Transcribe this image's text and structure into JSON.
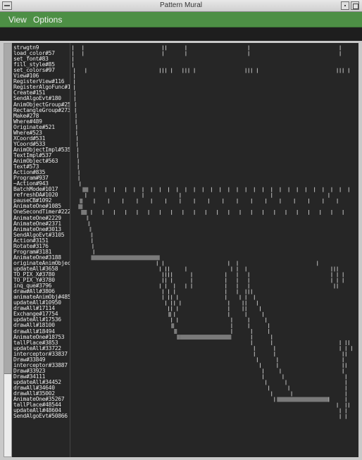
{
  "window": {
    "title": "Pattern Mural"
  },
  "menu": {
    "items": [
      "View",
      "Options"
    ]
  },
  "scrollbar": {
    "thumb_fraction": 0.8
  },
  "colors": {
    "bar": "#7a7a7a",
    "tick": "#bdbdbd",
    "panel": "#262626",
    "menubar": "#4d8f45"
  },
  "chart_data": {
    "type": "event-mural",
    "rows": [
      {
        "label": "strwgtn9",
        "events": [
          {
            "x": 0.005
          },
          {
            "x": 0.04
          },
          {
            "x": 0.32
          },
          {
            "x": 0.33
          },
          {
            "x": 0.4
          },
          {
            "x": 0.62
          },
          {
            "x": 0.94
          }
        ]
      },
      {
        "label": "load_color#57",
        "events": [
          {
            "x": 0.005
          },
          {
            "x": 0.04
          },
          {
            "x": 0.32
          },
          {
            "x": 0.4
          },
          {
            "x": 0.62
          },
          {
            "x": 0.94
          }
        ]
      },
      {
        "label": "set_font#83",
        "events": [
          {
            "x": 0.005
          }
        ]
      },
      {
        "label": "fill_style#85",
        "events": [
          {
            "x": 0.005
          }
        ]
      },
      {
        "label": "set_colors#97",
        "events": [
          {
            "x": 0.01
          },
          {
            "x": 0.05
          },
          {
            "x": 0.31
          },
          {
            "x": 0.32
          },
          {
            "x": 0.33
          },
          {
            "x": 0.35
          },
          {
            "x": 0.39
          },
          {
            "x": 0.4
          },
          {
            "x": 0.41
          },
          {
            "x": 0.43
          },
          {
            "x": 0.61
          },
          {
            "x": 0.62
          },
          {
            "x": 0.63
          },
          {
            "x": 0.65
          },
          {
            "x": 0.93
          },
          {
            "x": 0.94
          },
          {
            "x": 0.95
          },
          {
            "x": 0.97
          }
        ]
      },
      {
        "label": "View#106",
        "events": [
          {
            "x": 0.01
          }
        ]
      },
      {
        "label": "RegisterView#116",
        "events": [
          {
            "x": 0.01
          }
        ]
      },
      {
        "label": "RegisterAlgoFunc#128",
        "events": [
          {
            "x": 0.01
          }
        ]
      },
      {
        "label": "Create#151",
        "events": [
          {
            "x": 0.012
          }
        ]
      },
      {
        "label": "SendAlgoEvt#180",
        "events": [
          {
            "x": 0.012
          }
        ]
      },
      {
        "label": "AnimObjectGroup#257",
        "events": [
          {
            "x": 0.014
          }
        ]
      },
      {
        "label": "RectangleGroup#273",
        "events": [
          {
            "x": 0.014
          }
        ]
      },
      {
        "label": "Make#278",
        "events": [
          {
            "x": 0.016
          }
        ]
      },
      {
        "label": "Where#489",
        "events": [
          {
            "x": 0.016
          }
        ]
      },
      {
        "label": "Originate#521",
        "events": [
          {
            "x": 0.018
          }
        ]
      },
      {
        "label": "Where#523",
        "events": [
          {
            "x": 0.018
          }
        ]
      },
      {
        "label": "XCoord#531",
        "events": [
          {
            "x": 0.02
          }
        ]
      },
      {
        "label": "YCoord#533",
        "events": [
          {
            "x": 0.02
          }
        ]
      },
      {
        "label": "AnimObjectImpl#535",
        "events": [
          {
            "x": 0.022
          }
        ]
      },
      {
        "label": "TextImpl#537",
        "events": [
          {
            "x": 0.022
          }
        ]
      },
      {
        "label": "AnimObject#563",
        "events": [
          {
            "x": 0.024
          }
        ]
      },
      {
        "label": "Text#573",
        "events": [
          {
            "x": 0.024
          }
        ]
      },
      {
        "label": "Action#835",
        "events": [
          {
            "x": 0.026
          }
        ]
      },
      {
        "label": "Program#937",
        "events": [
          {
            "x": 0.026
          }
        ]
      },
      {
        "label": "~Action#943",
        "events": [
          {
            "x": 0.03
          }
        ]
      },
      {
        "label": "BatchMode#1017",
        "events": [
          {
            "x": 0.04,
            "w": 0.02
          },
          {
            "x": 0.08
          },
          {
            "x": 0.12
          },
          {
            "x": 0.15
          },
          {
            "x": 0.19
          },
          {
            "x": 0.22
          },
          {
            "x": 0.25
          },
          {
            "x": 0.28
          },
          {
            "x": 0.31
          },
          {
            "x": 0.34
          },
          {
            "x": 0.37
          },
          {
            "x": 0.4
          },
          {
            "x": 0.43
          },
          {
            "x": 0.46
          },
          {
            "x": 0.49
          },
          {
            "x": 0.52
          },
          {
            "x": 0.55
          },
          {
            "x": 0.58
          },
          {
            "x": 0.61
          },
          {
            "x": 0.64
          },
          {
            "x": 0.67
          },
          {
            "x": 0.7
          },
          {
            "x": 0.73
          },
          {
            "x": 0.76
          },
          {
            "x": 0.79
          },
          {
            "x": 0.82
          },
          {
            "x": 0.85
          },
          {
            "x": 0.88
          },
          {
            "x": 0.91
          },
          {
            "x": 0.94
          },
          {
            "x": 0.97
          }
        ]
      },
      {
        "label": "refreshDA#1020",
        "events": [
          {
            "x": 0.05
          },
          {
            "x": 0.25
          },
          {
            "x": 0.38
          },
          {
            "x": 0.7
          },
          {
            "x": 0.9
          }
        ]
      },
      {
        "label": "pauseCB#1092",
        "events": [
          {
            "x": 0.03,
            "w": 0.01
          },
          {
            "x": 0.08
          },
          {
            "x": 0.13
          },
          {
            "x": 0.18
          },
          {
            "x": 0.23
          },
          {
            "x": 0.28
          },
          {
            "x": 0.33
          },
          {
            "x": 0.38
          },
          {
            "x": 0.43
          },
          {
            "x": 0.48
          },
          {
            "x": 0.53
          },
          {
            "x": 0.58
          },
          {
            "x": 0.63
          },
          {
            "x": 0.68
          },
          {
            "x": 0.73
          },
          {
            "x": 0.78
          },
          {
            "x": 0.83
          },
          {
            "x": 0.88
          },
          {
            "x": 0.93
          }
        ]
      },
      {
        "label": "AnimateOne#1085",
        "events": [
          {
            "x": 0.025,
            "w": 0.015
          }
        ]
      },
      {
        "label": "OneSecondTimer#2227",
        "events": [
          {
            "x": 0.035,
            "w": 0.02
          },
          {
            "x": 0.07
          },
          {
            "x": 0.11
          },
          {
            "x": 0.15
          },
          {
            "x": 0.19
          },
          {
            "x": 0.23
          },
          {
            "x": 0.27
          },
          {
            "x": 0.31
          },
          {
            "x": 0.35
          },
          {
            "x": 0.39
          },
          {
            "x": 0.43
          },
          {
            "x": 0.47
          },
          {
            "x": 0.51
          },
          {
            "x": 0.55
          },
          {
            "x": 0.59
          },
          {
            "x": 0.63
          },
          {
            "x": 0.67
          },
          {
            "x": 0.71
          },
          {
            "x": 0.75
          },
          {
            "x": 0.79
          },
          {
            "x": 0.83
          },
          {
            "x": 0.87
          },
          {
            "x": 0.91
          },
          {
            "x": 0.95
          }
        ]
      },
      {
        "label": "AnimateOne#2229",
        "events": [
          {
            "x": 0.055,
            "w": 0.005
          }
        ]
      },
      {
        "label": "AnimateOne#2371",
        "events": [
          {
            "x": 0.06,
            "w": 0.005
          }
        ]
      },
      {
        "label": "AnimateOne#3013",
        "events": [
          {
            "x": 0.065,
            "w": 0.005
          }
        ]
      },
      {
        "label": "SendAlgoEvt#3105",
        "events": [
          {
            "x": 0.07,
            "w": 0.005
          }
        ]
      },
      {
        "label": "Action#3151",
        "events": [
          {
            "x": 0.072
          }
        ]
      },
      {
        "label": "Rotate#3176",
        "events": [
          {
            "x": 0.075
          }
        ]
      },
      {
        "label": "Program#3181",
        "events": [
          {
            "x": 0.078
          }
        ]
      },
      {
        "label": "AnimateOne#3188",
        "events": [
          {
            "x": 0.07,
            "w": 0.02
          },
          {
            "x": 0.09,
            "w": 0.22
          }
        ]
      },
      {
        "label": "originateAnimObjects",
        "events": [
          {
            "x": 0.3
          },
          {
            "x": 0.32
          },
          {
            "x": 0.55
          },
          {
            "x": 0.58
          },
          {
            "x": 0.86
          }
        ]
      },
      {
        "label": "updateAll#3658",
        "events": [
          {
            "x": 0.31
          },
          {
            "x": 0.33
          },
          {
            "x": 0.34
          },
          {
            "x": 0.4
          },
          {
            "x": 0.56
          },
          {
            "x": 0.58
          },
          {
            "x": 0.61
          },
          {
            "x": 0.91
          },
          {
            "x": 0.92
          },
          {
            "x": 0.93
          }
        ]
      },
      {
        "label": "TO_PIX_X#3780",
        "events": [
          {
            "x": 0.32
          },
          {
            "x": 0.33
          },
          {
            "x": 0.34
          },
          {
            "x": 0.35
          },
          {
            "x": 0.42
          },
          {
            "x": 0.54
          },
          {
            "x": 0.58
          },
          {
            "x": 0.62
          },
          {
            "x": 0.91
          },
          {
            "x": 0.93
          },
          {
            "x": 0.95
          }
        ]
      },
      {
        "label": "TO_PIX_Y#3780",
        "events": [
          {
            "x": 0.32
          },
          {
            "x": 0.33
          },
          {
            "x": 0.35
          },
          {
            "x": 0.42
          },
          {
            "x": 0.54
          },
          {
            "x": 0.58
          },
          {
            "x": 0.62
          },
          {
            "x": 0.91
          },
          {
            "x": 0.93
          },
          {
            "x": 0.95
          }
        ]
      },
      {
        "label": "inq_que#3796",
        "events": [
          {
            "x": 0.31
          },
          {
            "x": 0.33
          },
          {
            "x": 0.36
          },
          {
            "x": 0.4
          },
          {
            "x": 0.42
          },
          {
            "x": 0.54
          },
          {
            "x": 0.58
          },
          {
            "x": 0.62
          },
          {
            "x": 0.92
          },
          {
            "x": 0.93
          }
        ]
      },
      {
        "label": "draw#All#3806",
        "events": [
          {
            "x": 0.32
          },
          {
            "x": 0.34
          },
          {
            "x": 0.36
          },
          {
            "x": 0.54
          },
          {
            "x": 0.58
          },
          {
            "x": 0.61
          },
          {
            "x": 0.62
          },
          {
            "x": 0.63
          }
        ]
      },
      {
        "label": "animateAnimObj#4850",
        "events": [
          {
            "x": 0.32
          },
          {
            "x": 0.34
          },
          {
            "x": 0.35
          },
          {
            "x": 0.37
          },
          {
            "x": 0.54
          },
          {
            "x": 0.59
          },
          {
            "x": 0.61
          },
          {
            "x": 0.64
          }
        ]
      },
      {
        "label": "updateAll#10950",
        "events": [
          {
            "x": 0.33
          },
          {
            "x": 0.35
          },
          {
            "x": 0.36
          },
          {
            "x": 0.38
          },
          {
            "x": 0.55
          },
          {
            "x": 0.6
          },
          {
            "x": 0.61
          },
          {
            "x": 0.65
          }
        ]
      },
      {
        "label": "drawAll#17114",
        "events": [
          {
            "x": 0.34
          },
          {
            "x": 0.35
          },
          {
            "x": 0.37
          },
          {
            "x": 0.55
          },
          {
            "x": 0.6
          },
          {
            "x": 0.61
          },
          {
            "x": 0.66
          }
        ]
      },
      {
        "label": "Exchange#17754",
        "events": [
          {
            "x": 0.34,
            "w": 0.01
          },
          {
            "x": 0.36
          },
          {
            "x": 0.55
          },
          {
            "x": 0.61
          },
          {
            "x": 0.67
          }
        ]
      },
      {
        "label": "updateAll#17536",
        "events": [
          {
            "x": 0.35
          },
          {
            "x": 0.37
          },
          {
            "x": 0.56
          },
          {
            "x": 0.62
          },
          {
            "x": 0.68
          }
        ]
      },
      {
        "label": "drawAll#18100",
        "events": [
          {
            "x": 0.35,
            "w": 0.01
          },
          {
            "x": 0.56
          },
          {
            "x": 0.62
          },
          {
            "x": 0.69
          }
        ]
      },
      {
        "label": "drawAll#18494",
        "events": [
          {
            "x": 0.36,
            "w": 0.01
          },
          {
            "x": 0.56
          },
          {
            "x": 0.63
          },
          {
            "x": 0.69
          }
        ]
      },
      {
        "label": "AnimateOne#18753",
        "events": [
          {
            "x": 0.37,
            "w": 0.01
          },
          {
            "x": 0.38,
            "w": 0.18
          },
          {
            "x": 0.63
          },
          {
            "x": 0.7
          }
        ]
      },
      {
        "label": "tallPlace#3853",
        "events": [
          {
            "x": 0.63
          },
          {
            "x": 0.7
          },
          {
            "x": 0.94
          },
          {
            "x": 0.96
          },
          {
            "x": 0.97
          }
        ]
      },
      {
        "label": "updateAll#33722",
        "events": [
          {
            "x": 0.64
          },
          {
            "x": 0.71
          },
          {
            "x": 0.94
          },
          {
            "x": 0.96
          },
          {
            "x": 0.98
          }
        ]
      },
      {
        "label": "interceptor#33837",
        "events": [
          {
            "x": 0.64
          },
          {
            "x": 0.71
          },
          {
            "x": 0.95
          },
          {
            "x": 0.96
          }
        ]
      },
      {
        "label": "Draw#33849",
        "events": [
          {
            "x": 0.65
          },
          {
            "x": 0.72
          },
          {
            "x": 0.95
          }
        ]
      },
      {
        "label": "interceptor#33887",
        "events": [
          {
            "x": 0.66
          },
          {
            "x": 0.72
          },
          {
            "x": 0.95
          },
          {
            "x": 0.96
          }
        ]
      },
      {
        "label": "Draw#33923",
        "events": [
          {
            "x": 0.67
          },
          {
            "x": 0.73
          },
          {
            "x": 0.95
          }
        ]
      },
      {
        "label": "Draw#34111",
        "events": [
          {
            "x": 0.67
          },
          {
            "x": 0.74
          },
          {
            "x": 0.96
          }
        ]
      },
      {
        "label": "updateAll#34452",
        "events": [
          {
            "x": 0.68
          },
          {
            "x": 0.75
          },
          {
            "x": 0.96
          }
        ]
      },
      {
        "label": "drawAll#34640",
        "events": [
          {
            "x": 0.69
          },
          {
            "x": 0.76
          },
          {
            "x": 0.96
          }
        ]
      },
      {
        "label": "drawAll#35002",
        "events": [
          {
            "x": 0.7
          },
          {
            "x": 0.77
          },
          {
            "x": 0.96
          }
        ]
      },
      {
        "label": "AnimateOne#35267",
        "events": [
          {
            "x": 0.71
          },
          {
            "x": 0.72,
            "w": 0.18
          },
          {
            "x": 0.9
          },
          {
            "x": 0.96
          }
        ]
      },
      {
        "label": "tallPlace#48544",
        "events": [
          {
            "x": 0.93
          },
          {
            "x": 0.96
          },
          {
            "x": 0.97
          }
        ]
      },
      {
        "label": "updateAll#48604",
        "events": [
          {
            "x": 0.94
          },
          {
            "x": 0.96
          }
        ]
      },
      {
        "label": "SendAlgoEvt#50866",
        "events": [
          {
            "x": 0.94
          },
          {
            "x": 0.96
          }
        ]
      }
    ]
  }
}
